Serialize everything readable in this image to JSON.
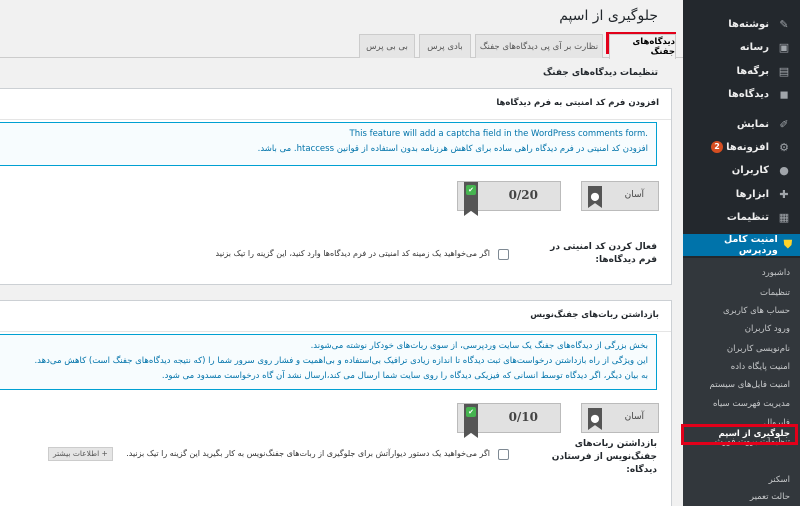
{
  "page": {
    "title": "جلوگیری از اسپم",
    "section_heading": "تنظیمات دیدگاه‌های جفنگ"
  },
  "tabs": [
    {
      "label": "دیدگاه‌های جفنگ",
      "active": true
    },
    {
      "label": "نظارت بر آی پی دیدگاه‌های جفنگ",
      "active": false
    },
    {
      "label": "بادی پرس",
      "active": false
    },
    {
      "label": "بی بی پرس",
      "active": false
    }
  ],
  "sidebar": {
    "items": [
      {
        "label": "نوشته‌ها",
        "icon": "pin-icon"
      },
      {
        "label": "رسانه",
        "icon": "media-icon"
      },
      {
        "label": "برگه‌ها",
        "icon": "pages-icon"
      },
      {
        "label": "دیدگاه‌ها",
        "icon": "comments-icon"
      },
      {
        "label": "نمایش",
        "icon": "brush-icon"
      },
      {
        "label": "افزونه‌ها",
        "icon": "plugin-icon",
        "badge": "2"
      },
      {
        "label": "کاربران",
        "icon": "users-icon"
      },
      {
        "label": "ابزارها",
        "icon": "wrench-icon"
      },
      {
        "label": "تنظیمات",
        "icon": "settings-icon"
      }
    ],
    "active_plugin": {
      "label": "امنیت کامل وردپرس",
      "icon": "shield-icon"
    },
    "submenu": [
      "داشبورد",
      "تنظیمات",
      "حساب های کاربری",
      "ورود کاربران",
      "نام‌نویسی کاربران",
      "امنیت پایگاه داده",
      "امنیت فایل‌های سیستم",
      "مدیریت فهرست سیاه",
      "فایروال",
      "تنظیمات بروت فورث",
      "جلوگیری از اسپم",
      "اسکنر",
      "حالت تعمیر"
    ],
    "submenu_current": "جلوگیری از اسپم"
  },
  "panel1": {
    "title": "افزودن فرم کد امنیتی به فرم دیدگاه‌ها",
    "notice": [
      "This feature will add a captcha field in the WordPress comments form.",
      "افزودن کد امنیتی در فرم دیدگاه راهی ساده برای کاهش هرزنامه بدون استفاده از قوانین htaccess. می باشد."
    ],
    "level": "آسان",
    "score": "0/20",
    "option_label": "فعال کردن کد امنیتی در فرم دیدگاه‌ها:",
    "option_desc": "اگر می‌خواهید یک زمینه کد امنیتی در فرم دیدگاه‌ها وارد کنید، این گزینه را تیک بزنید"
  },
  "panel2": {
    "title": "بازداشتن ربات‌های جفنگ‌نویس",
    "notice": [
      "بخش بزرگی از دیدگاه‌های جفنگ یک سایت وردپرسی، از سوی ربات‌های خودکار نوشته می‌شوند.",
      "این ویژگی از راه بازداشتن درخواست‌های ثبت دیدگاه تا اندازه زیادی ترافیک بی‌استفاده و بی‌اهمیت و فشار روی سرور شما را (که نتیجه دیدگاه‌های جفنگ است) کاهش می‌دهد.",
      "به بیان دیگر، اگر دیدگاه توسط انسانی که فیزیکی دیدگاه را روی سایت شما ارسال می کند،ارسال نشد آن گاه درخواست مسدود می شود."
    ],
    "level": "آسان",
    "score": "0/10",
    "option_label": "بازداشتن ربات‌های جفنگ‌نویس از فرستادن دیدگاه:",
    "option_desc": "اگر می‌خواهید یک دستور دیوارآتش برای جلوگیری از ربات‌های جفنگ‌نویس به کار بگیرید این گزینه را تیک بزنید.",
    "more_info": "+ اطلاعات بیشتر"
  },
  "colors": {
    "sidebar_bg": "#23282d",
    "submenu_bg": "#32373c",
    "accent": "#0073aa",
    "highlight": "#e2001a"
  }
}
